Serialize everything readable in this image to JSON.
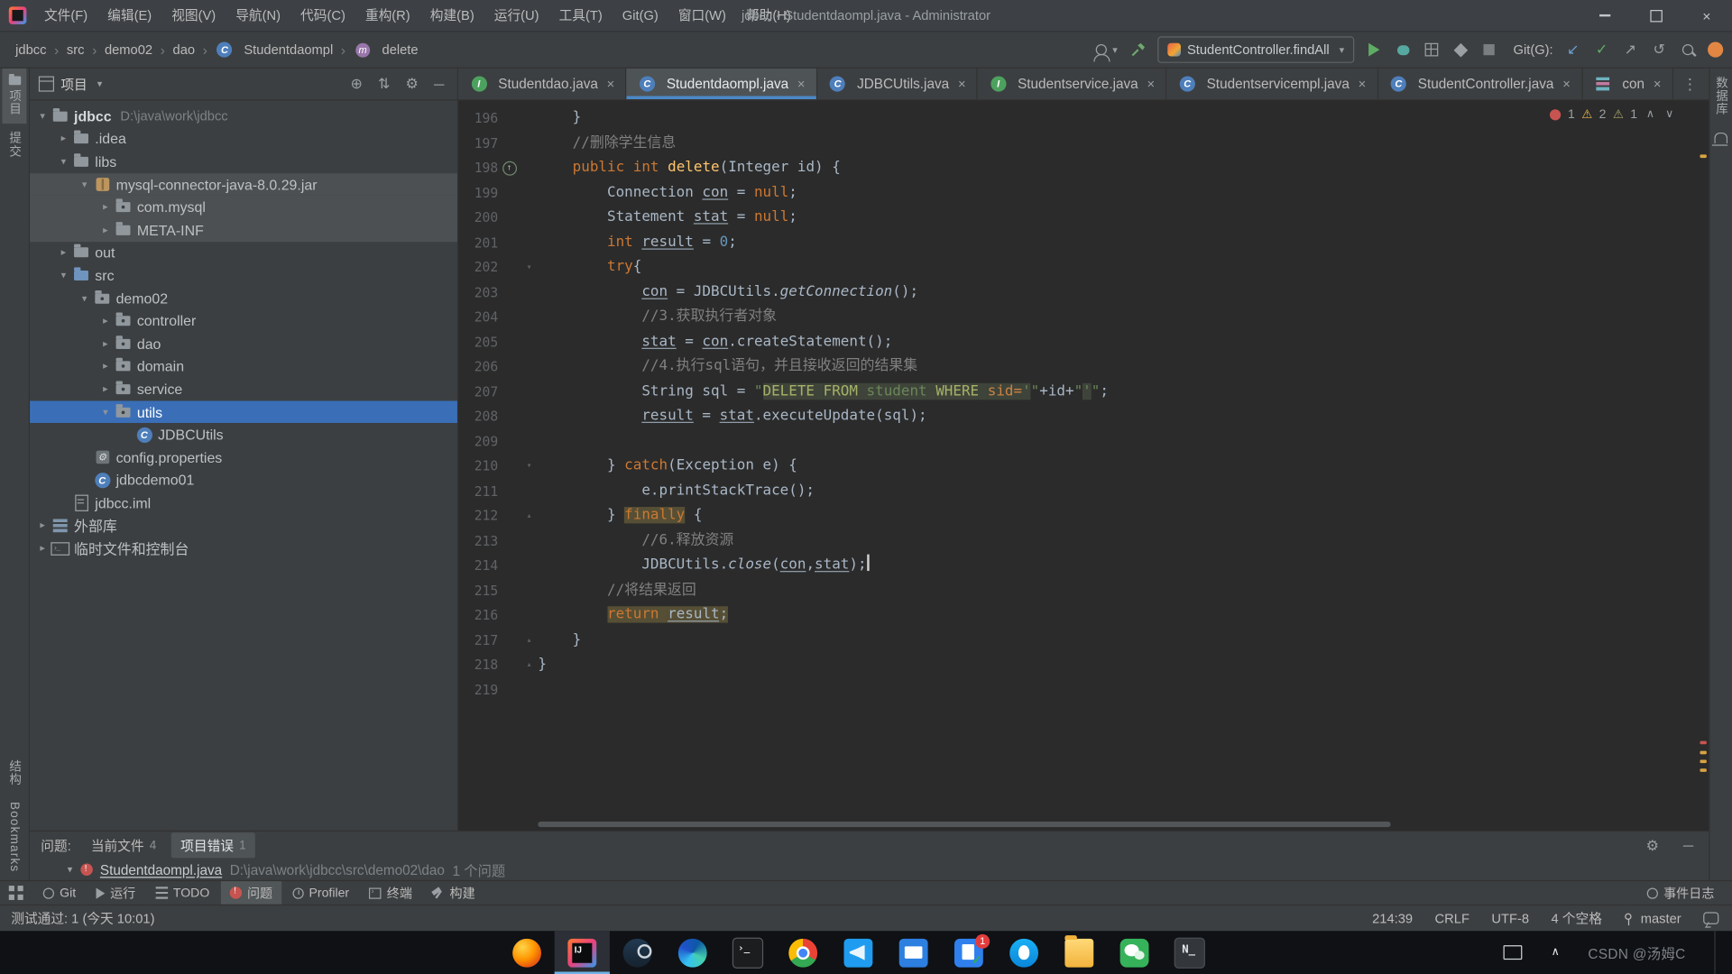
{
  "colors": {
    "accent_blue": "#4a88c7",
    "selection_blue": "#3a6fb8",
    "error_red": "#c75450",
    "warning_yellow": "#e8b64c",
    "editor_bg": "#2b2b2b",
    "panel_bg": "#3c3f41"
  },
  "titlebar": {
    "title": "jdbcc - Studentdaompl.java - Administrator",
    "menus": [
      "文件(F)",
      "编辑(E)",
      "视图(V)",
      "导航(N)",
      "代码(C)",
      "重构(R)",
      "构建(B)",
      "运行(U)",
      "工具(T)",
      "Git(G)",
      "窗口(W)",
      "帮助(H)"
    ]
  },
  "navbar": {
    "breadcrumbs": [
      {
        "label": "jdbcc"
      },
      {
        "label": "src"
      },
      {
        "label": "demo02"
      },
      {
        "label": "dao"
      },
      {
        "label": "Studentdaompl",
        "icon": "class-c"
      },
      {
        "label": "delete",
        "icon": "method"
      }
    ],
    "run_config": "StudentController.findAll",
    "git_label": "Git(G):"
  },
  "stripes": {
    "left_top": "项目",
    "left_mid": "提交",
    "left_bottom1": "结构",
    "left_bottom2": "Bookmarks",
    "right_top": "数据库"
  },
  "project_panel": {
    "title": "项目",
    "tree": [
      {
        "depth": 0,
        "arrow": "v",
        "icon": "folder",
        "label": "jdbcc",
        "bold": true,
        "extra": "D:\\java\\work\\jdbcc"
      },
      {
        "depth": 1,
        "arrow": ">",
        "icon": "folder",
        "label": ".idea"
      },
      {
        "depth": 1,
        "arrow": "v",
        "icon": "folder",
        "label": "libs"
      },
      {
        "depth": 2,
        "arrow": "v",
        "icon": "jar",
        "label": "mysql-connector-java-8.0.29.jar",
        "hl": true
      },
      {
        "depth": 3,
        "arrow": ">",
        "icon": "package",
        "label": "com.mysql",
        "hl": true
      },
      {
        "depth": 3,
        "arrow": ">",
        "icon": "folder",
        "label": "META-INF",
        "hl": true
      },
      {
        "depth": 1,
        "arrow": ">",
        "icon": "folder",
        "label": "out"
      },
      {
        "depth": 1,
        "arrow": "v",
        "icon": "folder-src",
        "label": "src"
      },
      {
        "depth": 2,
        "arrow": "v",
        "icon": "package",
        "label": "demo02"
      },
      {
        "depth": 3,
        "arrow": ">",
        "icon": "package",
        "label": "controller"
      },
      {
        "depth": 3,
        "arrow": ">",
        "icon": "package",
        "label": "dao"
      },
      {
        "depth": 3,
        "arrow": ">",
        "icon": "package",
        "label": "domain"
      },
      {
        "depth": 3,
        "arrow": ">",
        "icon": "package",
        "label": "service"
      },
      {
        "depth": 3,
        "arrow": "v",
        "icon": "package",
        "label": "utils",
        "selected": true
      },
      {
        "depth": 4,
        "arrow": "",
        "icon": "class",
        "label": "JDBCUtils"
      },
      {
        "depth": 2,
        "arrow": "",
        "icon": "props",
        "label": "config.properties"
      },
      {
        "depth": 2,
        "arrow": "",
        "icon": "class",
        "label": "jdbcdemo01"
      },
      {
        "depth": 1,
        "arrow": "",
        "icon": "iml",
        "label": "jdbcc.iml"
      },
      {
        "depth": 0,
        "arrow": ">",
        "icon": "lib",
        "label": "外部库"
      },
      {
        "depth": 0,
        "arrow": ">",
        "icon": "console",
        "label": "临时文件和控制台"
      }
    ]
  },
  "tabs": {
    "items": [
      {
        "label": "Studentdao.java",
        "icon": "class-i"
      },
      {
        "label": "Studentdaompl.java",
        "icon": "class-c",
        "active": true
      },
      {
        "label": "JDBCUtils.java",
        "icon": "class-c"
      },
      {
        "label": "Studentservice.java",
        "icon": "class-i"
      },
      {
        "label": "Studentservicempl.java",
        "icon": "class-c"
      },
      {
        "label": "StudentController.java",
        "icon": "class-c"
      },
      {
        "label": "con",
        "icon": "contab"
      }
    ]
  },
  "inspections": {
    "errors": "1",
    "warnings": "2",
    "weak": "1"
  },
  "editor": {
    "lines": [
      {
        "n": 196,
        "segs": [
          [
            "d",
            "    }"
          ]
        ]
      },
      {
        "n": 197,
        "segs": [
          [
            "d",
            "    "
          ],
          [
            "c",
            "//删除学生信息"
          ]
        ]
      },
      {
        "n": 198,
        "gicon": "implement",
        "segs": [
          [
            "d",
            "    "
          ],
          [
            "k",
            "public"
          ],
          [
            "d",
            " "
          ],
          [
            "k",
            "int"
          ],
          [
            "d",
            " "
          ],
          [
            "m",
            "delete"
          ],
          [
            "d",
            "(Integer id) {"
          ]
        ]
      },
      {
        "n": 199,
        "segs": [
          [
            "d",
            "        Connection "
          ],
          [
            "u",
            "con"
          ],
          [
            "d",
            " = "
          ],
          [
            "k",
            "null"
          ],
          [
            "d",
            ";"
          ]
        ]
      },
      {
        "n": 200,
        "segs": [
          [
            "d",
            "        Statement "
          ],
          [
            "u",
            "stat"
          ],
          [
            "d",
            " = "
          ],
          [
            "k",
            "null"
          ],
          [
            "d",
            ";"
          ]
        ]
      },
      {
        "n": 201,
        "segs": [
          [
            "d",
            "        "
          ],
          [
            "k",
            "int"
          ],
          [
            "d",
            " "
          ],
          [
            "u",
            "result"
          ],
          [
            "d",
            " = "
          ],
          [
            "n2",
            "0"
          ],
          [
            "d",
            ";"
          ]
        ]
      },
      {
        "n": 202,
        "fold": "v",
        "segs": [
          [
            "d",
            "        "
          ],
          [
            "k",
            "try"
          ],
          [
            "d",
            "{"
          ]
        ]
      },
      {
        "n": 203,
        "segs": [
          [
            "d",
            "            "
          ],
          [
            "u",
            "con"
          ],
          [
            "d",
            " = JDBCUtils."
          ],
          [
            "i",
            "getConnection"
          ],
          [
            "d",
            "();"
          ]
        ]
      },
      {
        "n": 204,
        "segs": [
          [
            "d",
            "            "
          ],
          [
            "c",
            "//3.获取执行者对象"
          ]
        ]
      },
      {
        "n": 205,
        "segs": [
          [
            "d",
            "            "
          ],
          [
            "u",
            "stat"
          ],
          [
            "d",
            " = "
          ],
          [
            "u",
            "con"
          ],
          [
            "d",
            ".createStatement();"
          ]
        ]
      },
      {
        "n": 206,
        "segs": [
          [
            "d",
            "            "
          ],
          [
            "c",
            "//4.执行sql语句，并且接收返回的结果集"
          ]
        ]
      },
      {
        "n": 207,
        "segs": [
          [
            "d",
            "            String sql = "
          ],
          [
            "s",
            "\""
          ],
          [
            "sk",
            "DELETE"
          ],
          [
            "ss",
            " "
          ],
          [
            "sk",
            "FROM"
          ],
          [
            "ss",
            " student "
          ],
          [
            "sk",
            "WHERE"
          ],
          [
            "ss",
            " "
          ],
          [
            "sc",
            "sid="
          ],
          [
            "ss",
            "'"
          ],
          [
            "s",
            "\""
          ],
          [
            "d",
            "+id+"
          ],
          [
            "s",
            "\""
          ],
          [
            "ss",
            "'"
          ],
          [
            "s",
            "\""
          ],
          [
            "d",
            ";"
          ]
        ]
      },
      {
        "n": 208,
        "segs": [
          [
            "d",
            "            "
          ],
          [
            "u",
            "result"
          ],
          [
            "d",
            " = "
          ],
          [
            "u",
            "stat"
          ],
          [
            "d",
            ".executeUpdate(sql);"
          ]
        ]
      },
      {
        "n": 209,
        "segs": []
      },
      {
        "n": 210,
        "fold": "v",
        "segs": [
          [
            "d",
            "        } "
          ],
          [
            "k",
            "catch"
          ],
          [
            "d",
            "(Exception e) {"
          ]
        ]
      },
      {
        "n": 211,
        "segs": [
          [
            "d",
            "            e.printStackTrace();"
          ]
        ]
      },
      {
        "n": 212,
        "fold": "^",
        "segs": [
          [
            "d",
            "        } "
          ],
          [
            "k hl",
            "finally"
          ],
          [
            "d",
            " {"
          ]
        ]
      },
      {
        "n": 213,
        "segs": [
          [
            "d",
            "            "
          ],
          [
            "c",
            "//6.释放资源"
          ]
        ]
      },
      {
        "n": 214,
        "segs": [
          [
            "d",
            "            JDBCUtils."
          ],
          [
            "i",
            "close"
          ],
          [
            "d",
            "("
          ],
          [
            "u",
            "con"
          ],
          [
            "d",
            ","
          ],
          [
            "u",
            "stat"
          ],
          [
            "d",
            ");"
          ],
          [
            "caret",
            ""
          ]
        ]
      },
      {
        "n": 215,
        "segs": [
          [
            "d",
            "        "
          ],
          [
            "c",
            "//将结果返回"
          ]
        ]
      },
      {
        "n": 216,
        "segs": [
          [
            "d",
            "        "
          ],
          [
            "k hl",
            "return"
          ],
          [
            "hl",
            " "
          ],
          [
            "u hl",
            "result"
          ],
          [
            "hl",
            ";"
          ]
        ]
      },
      {
        "n": 217,
        "fold": "^",
        "segs": [
          [
            "d",
            "    }"
          ]
        ]
      },
      {
        "n": 218,
        "fold": "^",
        "segs": [
          [
            "d",
            "}"
          ]
        ]
      },
      {
        "n": 219,
        "segs": []
      }
    ]
  },
  "problems_panel": {
    "title": "问题:",
    "tabs": [
      {
        "label": "当前文件",
        "count": "4"
      },
      {
        "label": "项目错误",
        "count": "1",
        "active": true
      }
    ],
    "row": {
      "file": "Studentdaompl.java",
      "path": "D:\\java\\work\\jdbcc\\src\\demo02\\dao",
      "info": "1 个问题"
    }
  },
  "bottom_bar": {
    "items": [
      {
        "label": "Git",
        "icon": "git"
      },
      {
        "label": "运行",
        "icon": "run"
      },
      {
        "label": "TODO",
        "icon": "todo"
      },
      {
        "label": "问题",
        "icon": "problems",
        "active": true
      },
      {
        "label": "Profiler",
        "icon": "profiler"
      },
      {
        "label": "终端",
        "icon": "terminal"
      },
      {
        "label": "构建",
        "icon": "build"
      }
    ],
    "right": "事件日志"
  },
  "status_bar": {
    "left": "测试通过: 1 (今天 10:01)",
    "position": "214:39",
    "line_sep": "CRLF",
    "encoding": "UTF-8",
    "indent": "4 个空格",
    "branch": "master"
  },
  "taskbar": {
    "apps": [
      {
        "id": "firefox"
      },
      {
        "id": "idea",
        "active": true
      },
      {
        "id": "steam"
      },
      {
        "id": "edge"
      },
      {
        "id": "terminal"
      },
      {
        "id": "chrome"
      },
      {
        "id": "vscode"
      },
      {
        "id": "mail"
      },
      {
        "id": "meeting",
        "badge": "1"
      },
      {
        "id": "tim"
      },
      {
        "id": "explorer"
      },
      {
        "id": "wechat"
      },
      {
        "id": "notepad"
      }
    ],
    "watermark": "CSDN @汤姆C"
  }
}
